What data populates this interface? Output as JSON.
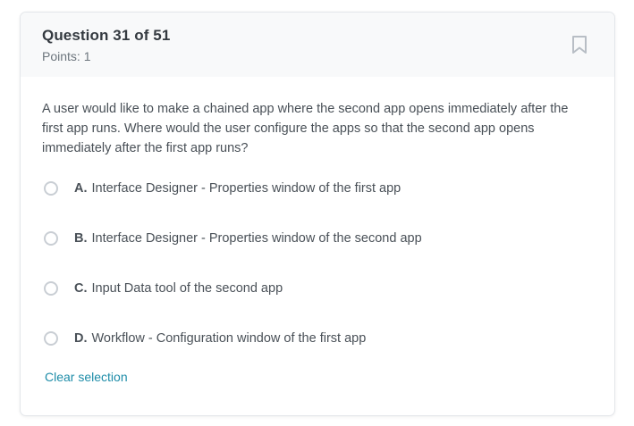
{
  "question": {
    "title": "Question 31 of 51",
    "points": "Points: 1",
    "text": "A user would like to make a chained app where the second app opens immediately after the first app runs. Where would the user configure the apps so that the second app opens immediately after the first app runs?"
  },
  "options": [
    {
      "letter": "A.",
      "text": "Interface Designer - Properties window of the first app"
    },
    {
      "letter": "B.",
      "text": "Interface Designer - Properties window of the second app"
    },
    {
      "letter": "C.",
      "text": "Input Data tool of the second app"
    },
    {
      "letter": "D.",
      "text": "Workflow - Configuration window of the first app"
    }
  ],
  "actions": {
    "clear_selection": "Clear selection"
  },
  "icons": {
    "bookmark": "bookmark-icon"
  },
  "colors": {
    "header_bg": "#f8f9fa",
    "link": "#1d8ca8",
    "text": "#495057",
    "title": "#343a40"
  }
}
